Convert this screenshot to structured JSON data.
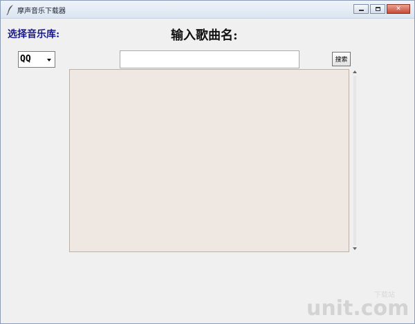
{
  "window": {
    "title": "摩声音乐下载器"
  },
  "form": {
    "library_label": "选择音乐库:",
    "song_label": "输入歌曲名:",
    "library_selected": "QQ",
    "search_value": "",
    "search_button": "搜索"
  },
  "icons": {
    "app": "feather-icon",
    "minimize": "minimize-icon",
    "maximize": "maximize-icon",
    "close": "close-icon"
  },
  "watermark": {
    "text": "unit.com",
    "subtitle": "下载站"
  }
}
